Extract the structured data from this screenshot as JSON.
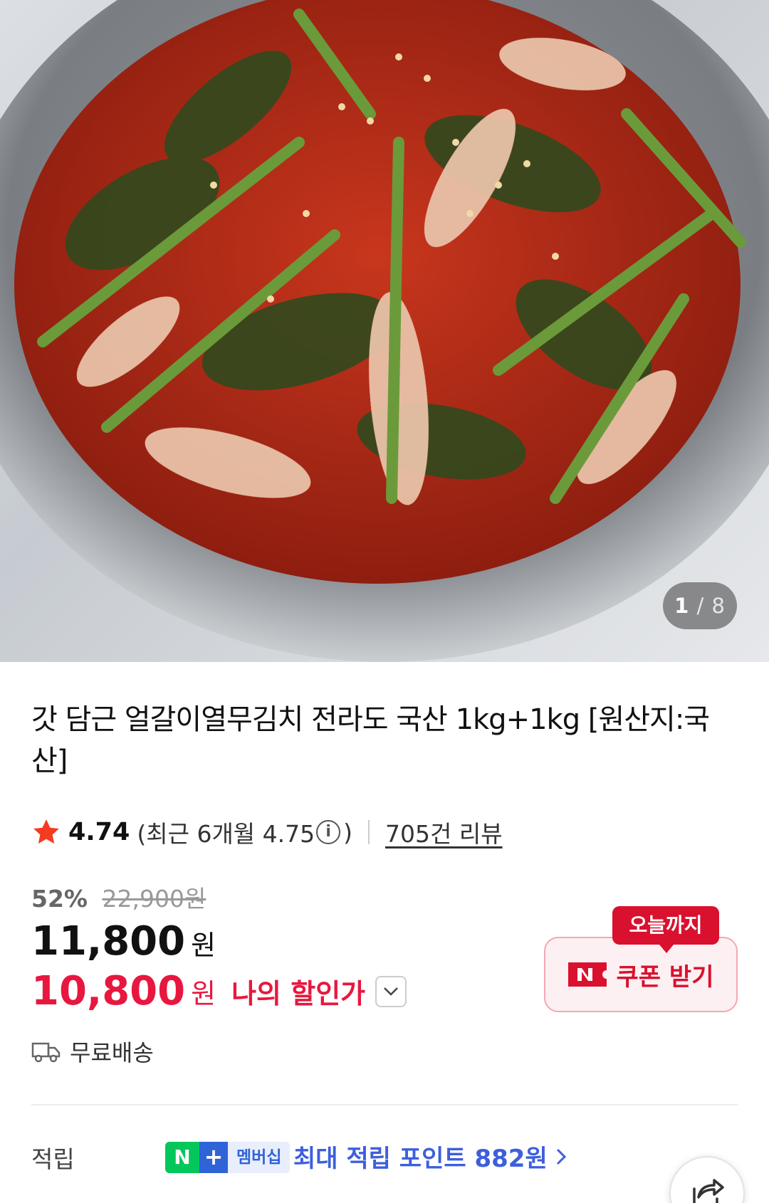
{
  "image_counter": {
    "current": "1",
    "separator": "/",
    "total": "8"
  },
  "product": {
    "title": "갓 담근 얼갈이열무김치 전라도 국산 1kg+1kg [원산지:국산]"
  },
  "rating": {
    "score": "4.74",
    "recent_label": "(최근 6개월 4.75",
    "recent_close": ")",
    "info_glyph": "i",
    "review_count": "705건 리뷰",
    "icon": "star-icon",
    "color": "#f53b20"
  },
  "price": {
    "discount_rate": "52%",
    "original": "22,900원",
    "sale": "11,800",
    "sale_unit": "원",
    "my_price": "10,800",
    "my_unit": "원",
    "my_label": "나의 할인가",
    "accent": "#e8173f"
  },
  "coupon": {
    "badge": "오늘까지",
    "label": "쿠폰 받기",
    "icon": "naver-n-icon"
  },
  "shipping": {
    "label": "무료배송",
    "icon": "truck-icon"
  },
  "points": {
    "label": "적립",
    "membership_n": "N",
    "membership_plus": "+",
    "membership_text": "멤버십",
    "text": "최대 적립 포인트 882원",
    "color": "#3d5fdc"
  },
  "share": {
    "icon": "share-icon"
  }
}
